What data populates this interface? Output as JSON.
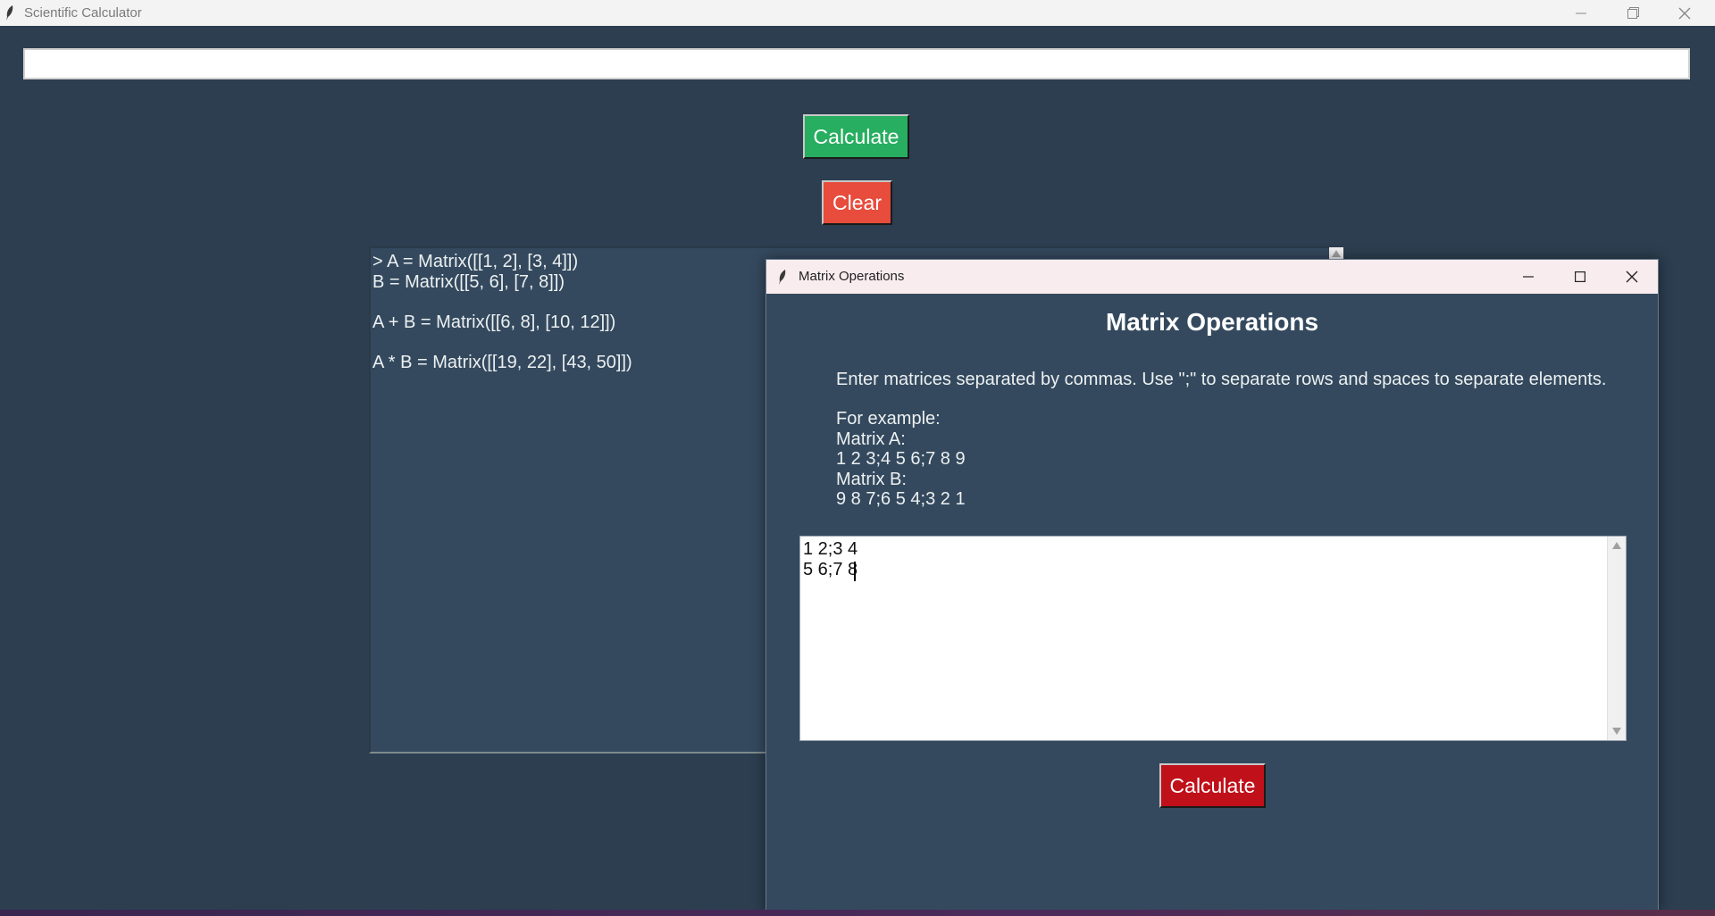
{
  "window": {
    "title": "Scientific Calculator",
    "controls": [
      "minimize",
      "maximize",
      "close"
    ]
  },
  "input": {
    "value": "",
    "placeholder": ""
  },
  "buttons": {
    "calculate_label": "Calculate",
    "clear_label": "Clear"
  },
  "output": {
    "lines": [
      "> A = Matrix([[1, 2], [3, 4]])",
      "B = Matrix([[5, 6], [7, 8]])",
      "",
      "A + B = Matrix([[6, 8], [10, 12]])",
      "",
      "A * B = Matrix([[19, 22], [43, 50]])"
    ]
  },
  "dialog": {
    "title": "Matrix Operations",
    "heading": "Matrix Operations",
    "instructions": "Enter matrices separated by commas. Use \";\" to separate rows and spaces to separate elements.",
    "example_lines": [
      "For example:",
      "Matrix A:",
      "1 2 3;4 5 6;7 8 9",
      "Matrix B:",
      "9 8 7;6 5 4;3 2 1"
    ],
    "matrix_input_lines": [
      "1 2;3 4",
      "5 6;7 8"
    ],
    "calculate_label": "Calculate"
  },
  "colors": {
    "background": "#2c3e50",
    "panel": "#34495e",
    "calculate_green": "#27ae60",
    "clear_red": "#e74c3c",
    "dialog_calculate_red": "#c0101a"
  }
}
